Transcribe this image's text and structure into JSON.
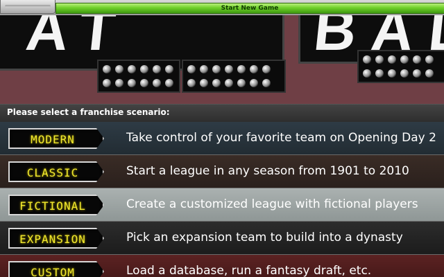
{
  "window": {
    "title": "Start New Game"
  },
  "background": {
    "scoreboard_left_text": "AT BAT",
    "scoreboard_right_text": "BALL"
  },
  "prompt": "Please select a franchise scenario:",
  "scenarios": [
    {
      "label": "MODERN",
      "description": "Take control of your favorite team on Opening Day 2",
      "color": "#2e3b45"
    },
    {
      "label": "CLASSIC",
      "description": "Start a league in any season from 1901 to 2010",
      "color": "#3a2c26"
    },
    {
      "label": "FICTIONAL",
      "description": "Create a customized league with fictional players",
      "color": "#aab1b0"
    },
    {
      "label": "EXPANSION",
      "description": "Pick an expansion team to build into a dynasty",
      "color": "#2c2c2c"
    },
    {
      "label": "CUSTOM",
      "description": "Load a database, run a fantasy draft, etc.",
      "color": "#5c2222"
    }
  ],
  "colors": {
    "led_text": "#f2ea2e",
    "title_bar_green": "#6fcf2a"
  }
}
